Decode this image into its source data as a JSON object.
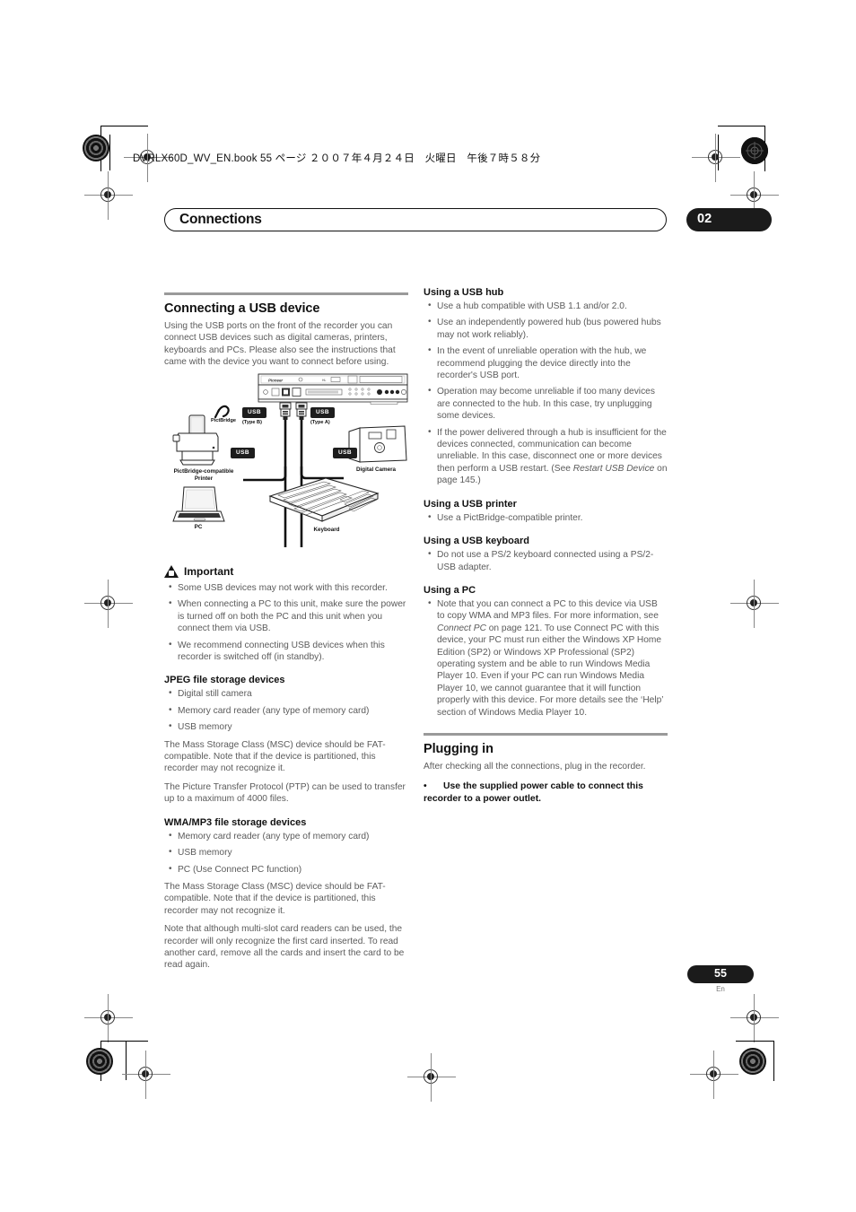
{
  "print_marks": {
    "file_header": "DVRLX60D_WV_EN.book 55 ページ ２００７年４月２４日　火曜日　午後７時５８分"
  },
  "chapter": {
    "title": "Connections",
    "number": "02"
  },
  "left_column": {
    "section_title": "Connecting a USB device",
    "intro": "Using the USB ports on the front of the recorder you can connect USB devices such as digital cameras, printers, keyboards and PCs. Please also see the instructions that came with the device you want to connect before using.",
    "diagram": {
      "brand": "Pioneer",
      "usb_tag_b": "USB",
      "usb_type_b": "(Type B)",
      "usb_tag_a": "USB",
      "usb_type_a": "(Type A)",
      "usb_tag_printer": "USB",
      "usb_tag_camera": "USB",
      "pictbridge_mark": "PictBridge",
      "printer_label": "PictBridge-compatible\nPrinter",
      "printer_label_line1": "PictBridge-compatible",
      "printer_label_line2": "Printer",
      "pc_label": "PC",
      "camera_label": "Digital Camera",
      "keyboard_label": "Keyboard"
    },
    "important": {
      "label": "Important",
      "bullets": [
        "Some USB devices may not work with this recorder.",
        "When connecting a PC to this unit, make sure the power is turned off on both the PC and this unit when you connect them via USB.",
        "We recommend connecting USB devices when this recorder is switched off (in standby)."
      ]
    },
    "jpeg_section": {
      "heading": "JPEG file storage devices",
      "bullets": [
        "Digital still camera",
        "Memory card reader (any type of memory card)",
        "USB memory"
      ],
      "paragraphs": [
        "The Mass Storage Class (MSC) device should be FAT-compatible. Note that if the device is partitioned, this recorder may not recognize it.",
        "The Picture Transfer Protocol (PTP) can be used to transfer up to a maximum of 4000 files."
      ]
    },
    "wma_section": {
      "heading": "WMA/MP3 file storage devices",
      "bullets": [
        "Memory card reader (any type of memory card)",
        "USB memory",
        "PC (Use Connect PC function)"
      ],
      "paragraphs": [
        "The Mass Storage Class (MSC) device should be FAT-compatible. Note that if the device is partitioned, this recorder may not recognize it.",
        "Note that although multi-slot card readers can be used, the recorder will only recognize the first card inserted. To read another card, remove all the cards and insert the card to be read again."
      ]
    }
  },
  "right_column": {
    "usb_hub": {
      "heading": "Using a USB hub",
      "bullets": [
        "Use a hub compatible with USB 1.1 and/or 2.0.",
        "Use an independently powered hub (bus powered hubs may not work reliably).",
        "In the event of unreliable operation with the hub, we recommend plugging the device directly into the recorder's USB port.",
        "Operation may become unreliable if too many devices are connected to the hub. In this case, try unplugging some devices."
      ],
      "last_bullet": {
        "pre": "If the power delivered through a hub is insufficient for the devices connected, communication can become unreliable. In this case, disconnect one or more devices then perform a USB restart. (See ",
        "italic": "Restart USB Device",
        "post": " on page 145.)"
      }
    },
    "usb_printer": {
      "heading": "Using a USB printer",
      "bullets": [
        "Use a PictBridge-compatible printer."
      ]
    },
    "usb_keyboard": {
      "heading": "Using a USB keyboard",
      "bullets": [
        "Do not use a PS/2 keyboard connected using a PS/2-USB adapter."
      ]
    },
    "using_pc": {
      "heading": "Using a PC",
      "bullet": {
        "pre": "Note that you can connect a PC to this device via USB to copy WMA and MP3 files. For more information, see ",
        "italic": "Connect PC",
        "post": " on page 121. To use Connect PC with this device, your PC must run either the Windows XP Home Edition (SP2) or Windows XP Professional (SP2) operating system and be able to run Windows Media Player 10. Even if your PC can run Windows Media Player 10, we cannot guarantee that it will function properly with this device. For more details see the ‘Help’ section of Windows Media Player 10."
      }
    },
    "plugging_in": {
      "section_title": "Plugging in",
      "intro": "After checking all the connections, plug in the recorder.",
      "bullet_bold": "Use the supplied power cable to connect this recorder to a power outlet."
    }
  },
  "footer": {
    "page_number": "55",
    "language": "En"
  },
  "colors": {
    "text_body": "#5b5b5b",
    "text_heading": "#111111",
    "rule": "#9a9a9a",
    "pill": "#1b1b1b"
  }
}
